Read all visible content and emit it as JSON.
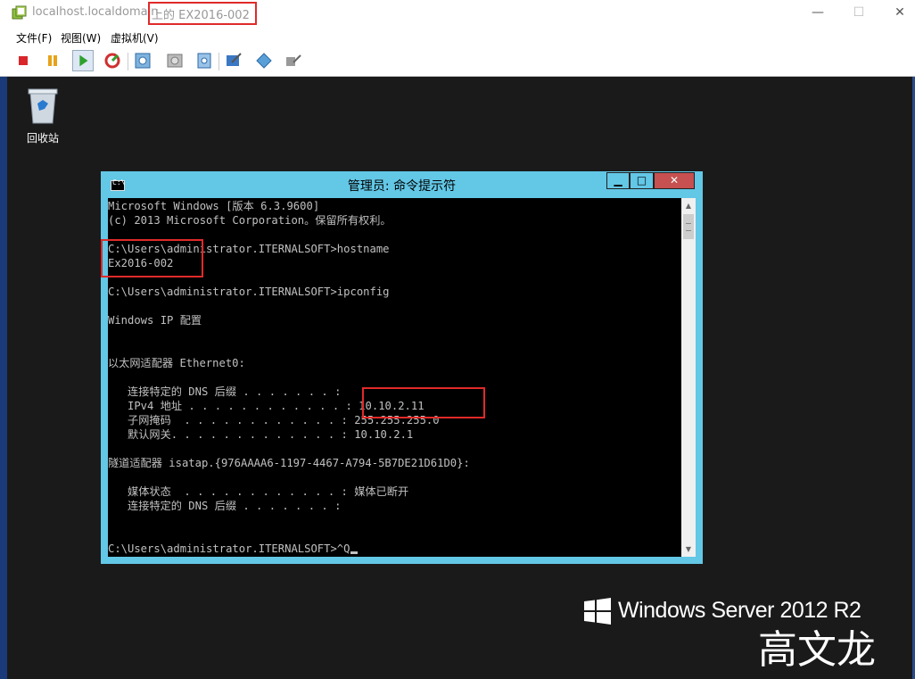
{
  "window": {
    "host_title": "localhost.localdomain",
    "vm_title": "上的 EX2016-002",
    "minimize": "—",
    "maximize": "☐",
    "close": "✕"
  },
  "menu": [
    "文件(F)",
    "视图(W)",
    "虚拟机(V)"
  ],
  "toolbar": {
    "buttons": [
      "stop-icon",
      "pause-icon",
      "play-icon",
      "reset-icon",
      "snapshot-icon",
      "revert-snapshot-icon",
      "manage-snapshots-icon",
      "edit-settings-icon",
      "console-tools-icon",
      "vm-settings-icon"
    ]
  },
  "desktop": {
    "recycle_bin_label": "回收站",
    "os_brand": "Windows Server 2012 R2",
    "watermark": "高文龙"
  },
  "cmd": {
    "title": "管理员: 命令提示符",
    "minimize": "▁",
    "maximize": "□",
    "close": "✕",
    "lines": [
      "Microsoft Windows [版本 6.3.9600]",
      "(c) 2013 Microsoft Corporation。保留所有权利。",
      "",
      "C:\\Users\\administrator.ITERNALSOFT>hostname",
      "Ex2016-002",
      "",
      "C:\\Users\\administrator.ITERNALSOFT>ipconfig",
      "",
      "Windows IP 配置",
      "",
      "",
      "以太网适配器 Ethernet0:",
      "",
      "   连接特定的 DNS 后缀 . . . . . . . :",
      "   IPv4 地址 . . . . . . . . . . . . : 10.10.2.11",
      "   子网掩码  . . . . . . . . . . . . : 255.255.255.0",
      "   默认网关. . . . . . . . . . . . . : 10.10.2.1",
      "",
      "隧道适配器 isatap.{976AAAA6-1197-4467-A794-5B7DE21D61D0}:",
      "",
      "   媒体状态  . . . . . . . . . . . . : 媒体已断开",
      "   连接特定的 DNS 后缀 . . . . . . . :",
      "",
      ""
    ],
    "prompt": "C:\\Users\\administrator.ITERNALSOFT>^Q"
  }
}
